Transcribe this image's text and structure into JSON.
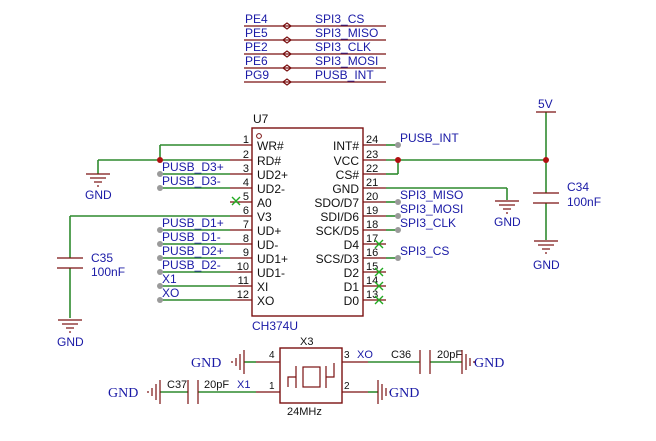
{
  "net_labels_top": [
    {
      "pin": "PE4",
      "net": "SPI3_CS"
    },
    {
      "pin": "PE5",
      "net": "SPI3_MISO"
    },
    {
      "pin": "PE2",
      "net": "SPI3_CLK"
    },
    {
      "pin": "PE6",
      "net": "SPI3_MOSI"
    },
    {
      "pin": "PG9",
      "net": "PUSB_INT"
    }
  ],
  "chip": {
    "designator": "U7",
    "part": "CH374U",
    "left_pins": [
      {
        "num": "1",
        "name": "WR#"
      },
      {
        "num": "2",
        "name": "RD#"
      },
      {
        "num": "3",
        "name": "UD2+"
      },
      {
        "num": "4",
        "name": "UD2-"
      },
      {
        "num": "5",
        "name": "A0"
      },
      {
        "num": "6",
        "name": "V3"
      },
      {
        "num": "7",
        "name": "UD+"
      },
      {
        "num": "8",
        "name": "UD-"
      },
      {
        "num": "9",
        "name": "UD1+"
      },
      {
        "num": "10",
        "name": "UD1-"
      },
      {
        "num": "11",
        "name": "XI"
      },
      {
        "num": "12",
        "name": "XO"
      }
    ],
    "right_pins": [
      {
        "num": "24",
        "name": "INT#"
      },
      {
        "num": "23",
        "name": "VCC"
      },
      {
        "num": "22",
        "name": "CS#"
      },
      {
        "num": "21",
        "name": "GND"
      },
      {
        "num": "20",
        "name": "SDO/D7"
      },
      {
        "num": "19",
        "name": "SDI/D6"
      },
      {
        "num": "18",
        "name": "SCK/D5"
      },
      {
        "num": "17",
        "name": "D4"
      },
      {
        "num": "16",
        "name": "SCS/D3"
      },
      {
        "num": "15",
        "name": "D2"
      },
      {
        "num": "14",
        "name": "D1"
      },
      {
        "num": "13",
        "name": "D0"
      }
    ]
  },
  "left_nets": {
    "pusb_d3p": "PUSB_D3+",
    "pusb_d3m": "PUSB_D3-",
    "pusb_d1p": "PUSB_D1+",
    "pusb_d1m": "PUSB_D1-",
    "pusb_d2p": "PUSB_D2+",
    "pusb_d2m": "PUSB_D2-",
    "xi": "X1",
    "xo": "XO"
  },
  "right_nets": {
    "int": "PUSB_INT",
    "miso": "SPI3_MISO",
    "mosi": "SPI3_MOSI",
    "clk": "SPI3_CLK",
    "cs": "SPI3_CS"
  },
  "power": {
    "label": "5V"
  },
  "gnd_label": "GND",
  "caps": {
    "c34": {
      "ref": "C34",
      "value": "100nF"
    },
    "c35": {
      "ref": "C35",
      "value": "100nF"
    },
    "c36": {
      "ref": "C36",
      "value": "20pF"
    },
    "c37": {
      "ref": "C37",
      "value": "20pF"
    }
  },
  "crystal": {
    "ref": "X3",
    "value": "24MHz",
    "pin1": "1",
    "pin2": "2",
    "pin3": "3",
    "pin4": "4",
    "net_xo": "XO",
    "net_x1": "X1"
  },
  "colors": {
    "wire": "#2f8a2f",
    "component": "#7a1010",
    "label": "#1a1aa6",
    "no_connect": "#22aa22"
  }
}
